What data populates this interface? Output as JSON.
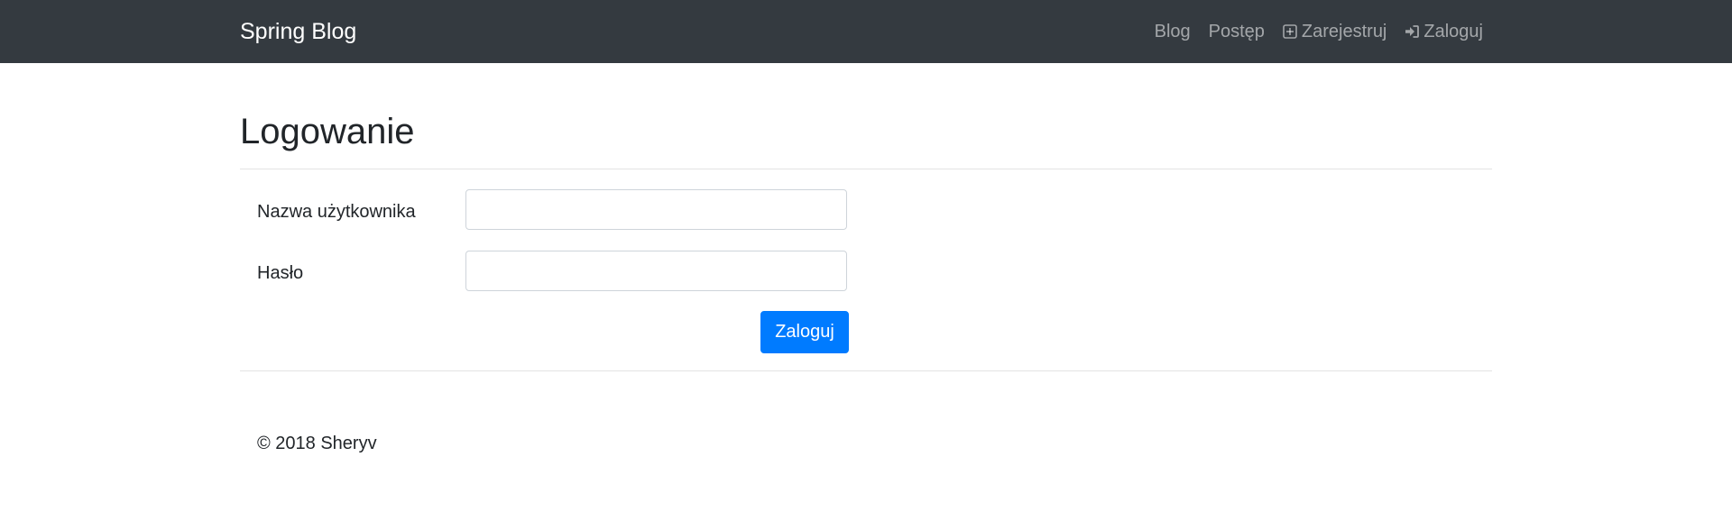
{
  "navbar": {
    "brand": "Spring Blog",
    "links": [
      {
        "label": "Blog",
        "icon": null
      },
      {
        "label": "Postęp",
        "icon": null
      },
      {
        "label": "Zarejestruj",
        "icon": "plus-square-icon"
      },
      {
        "label": "Zaloguj",
        "icon": "sign-in-icon"
      }
    ]
  },
  "page": {
    "title": "Logowanie"
  },
  "form": {
    "username_label": "Nazwa użytkownika",
    "username_value": "",
    "password_label": "Hasło",
    "password_value": "",
    "submit_label": "Zaloguj"
  },
  "footer": {
    "text": "© 2018 Sheryv"
  },
  "colors": {
    "navbar_bg": "#343a40",
    "primary": "#007bff",
    "nav_link": "rgba(255,255,255,0.55)"
  }
}
